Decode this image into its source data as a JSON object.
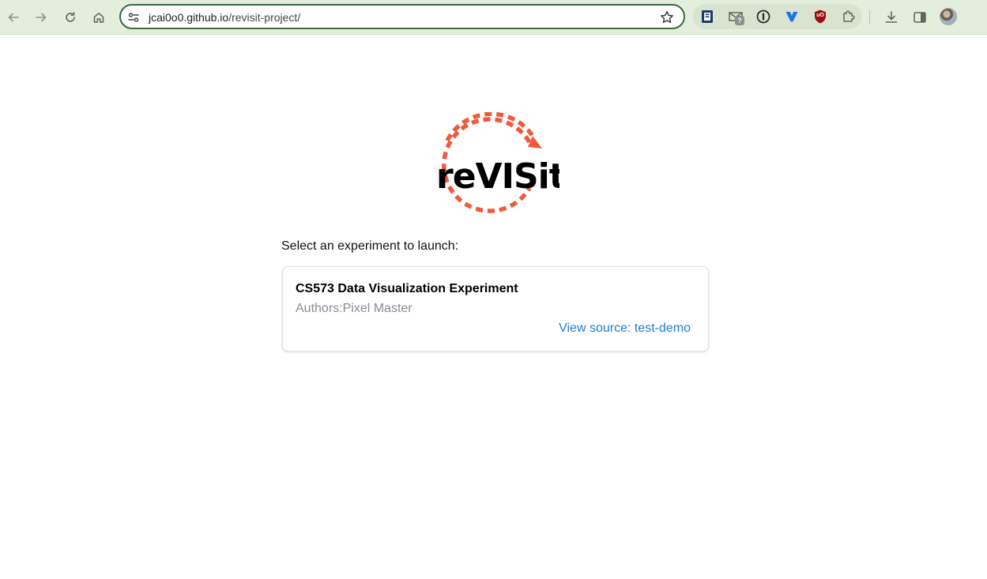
{
  "browser": {
    "url_host": "jcai0o0.github.io",
    "url_path": "/revisit-project/",
    "nav_icons": [
      "back-arrow-icon",
      "forward-arrow-icon",
      "reload-icon",
      "home-icon"
    ],
    "extension_icons": [
      "reader-mode-icon",
      "gmail-icon",
      "password-manager-icon",
      "vpn-icon",
      "ublock-icon",
      "puzzle-extensions-icon"
    ],
    "gmail_badge": "?",
    "ublock_label": "uO",
    "toolbar_color": "#e4eedc",
    "accent_color": "#3c6a40"
  },
  "logo": {
    "text": "reVISit",
    "accent_color": "#f05a3c"
  },
  "main": {
    "prompt": "Select an experiment to launch:",
    "experiments": [
      {
        "title": "CS573 Data Visualization Experiment",
        "authors": "Authors:Pixel Master",
        "source_link": "View source: test-demo",
        "link_color": "#1c7ed6"
      }
    ]
  }
}
